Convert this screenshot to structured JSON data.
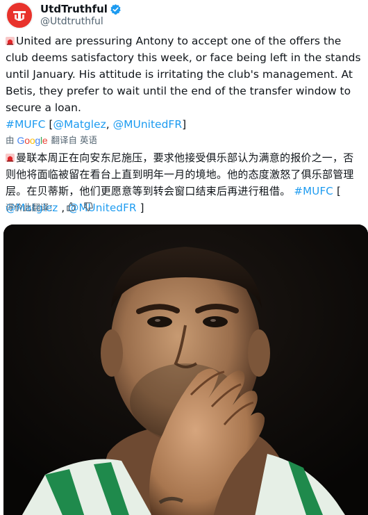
{
  "author": {
    "display_name": "UtdTruthful",
    "handle": "@Utdtruthful",
    "avatar_icon": "utd-logo-icon",
    "verified_icon": "verified-badge-icon",
    "brand_color": "#e8322b"
  },
  "tweet": {
    "emoji_icon": "police-light-icon",
    "english_text": "United are pressuring Antony to accept one of the offers the club deems satisfactory this week, or face being left in the stands until January. His attitude is irritating the club's management. At Betis, they prefer to wait until the end of the transfer window to secure a loan.",
    "english_hashtag": "#MUFC",
    "english_bracket_open": "[",
    "english_mention_1": "@Matglez",
    "english_comma": ",",
    "english_mention_2": "@MUnitedFR",
    "english_bracket_close": "]",
    "translated_by_prefix": "由",
    "translated_by_brand": "Google",
    "translated_from": "翻译自 英语",
    "chinese_text": "曼联本周正在向安东尼施压，要求他接受俱乐部认为满意的报价之一，否则他将面临被留在看台上直到明年一月的境地。他的态度激怒了俱乐部管理层。在贝蒂斯，他们更愿意等到转会窗口结束后再进行租借。",
    "chinese_hashtag": "#MUFC",
    "chinese_bracket_open": "[",
    "chinese_mention_1": "@Matglez",
    "chinese_comma": " ,",
    "chinese_mention_2": "@MUnitedFR",
    "chinese_bracket_close": "]",
    "rate_label": "评价此翻译：",
    "link_color": "#1d9bf0"
  },
  "media": {
    "icon": "player-photo"
  }
}
